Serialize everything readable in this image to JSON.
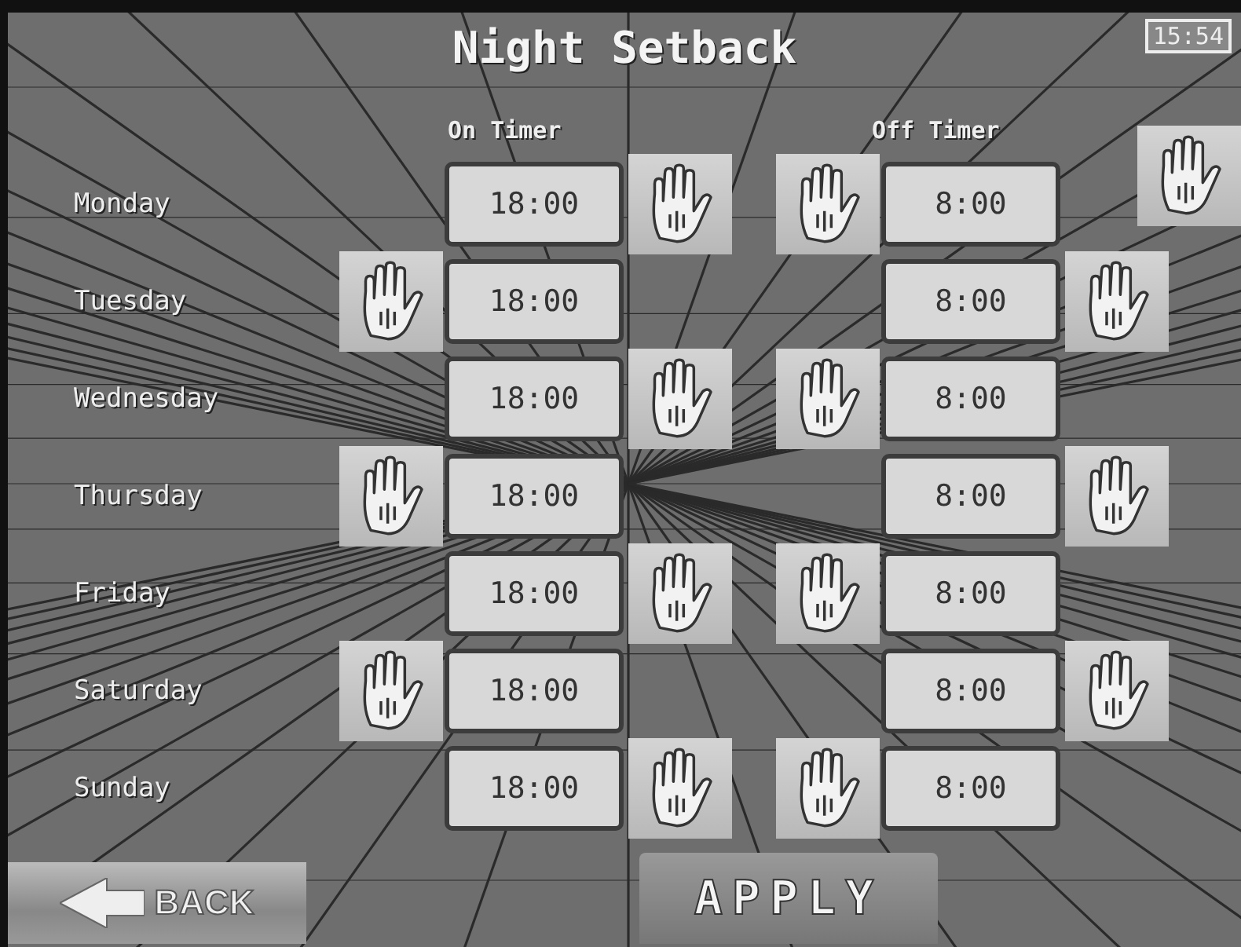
{
  "header": {
    "title": "Night Setback",
    "clock": "15:54"
  },
  "columns": {
    "on": "On Timer",
    "off": "Off Timer"
  },
  "days": [
    {
      "day": "Monday",
      "on_time": "18:00",
      "off_time": "8:00",
      "kind": "inner"
    },
    {
      "day": "Tuesday",
      "on_time": "18:00",
      "off_time": "8:00",
      "kind": "outer"
    },
    {
      "day": "Wednesday",
      "on_time": "18:00",
      "off_time": "8:00",
      "kind": "inner"
    },
    {
      "day": "Thursday",
      "on_time": "18:00",
      "off_time": "8:00",
      "kind": "outer"
    },
    {
      "day": "Friday",
      "on_time": "18:00",
      "off_time": "8:00",
      "kind": "inner"
    },
    {
      "day": "Saturday",
      "on_time": "18:00",
      "off_time": "8:00",
      "kind": "outer"
    },
    {
      "day": "Sunday",
      "on_time": "18:00",
      "off_time": "8:00",
      "kind": "inner"
    }
  ],
  "buttons": {
    "back": "BACK",
    "apply": "APPLY"
  }
}
